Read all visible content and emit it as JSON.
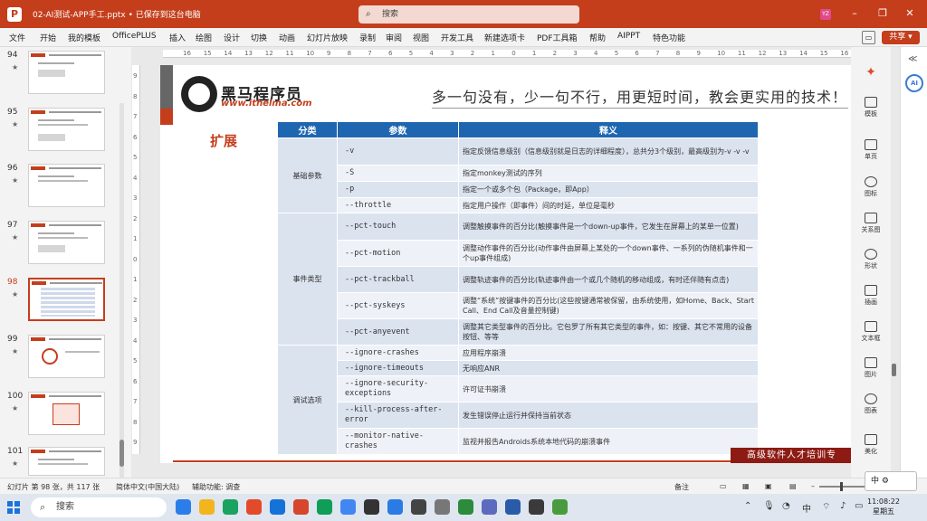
{
  "titlebar": {
    "app_icon": "P",
    "doc_title": "02-AI测试-APP手工.pptx • 已保存到这台电脑",
    "search_placeholder": "搜索",
    "user_initials": "YZ",
    "minimize": "–",
    "restore": "❐",
    "close": "✕"
  },
  "menu": [
    "文件",
    "开始",
    "我的模板",
    "OfficePLUS",
    "插入",
    "绘图",
    "设计",
    "切换",
    "动画",
    "幻灯片放映",
    "录制",
    "审阅",
    "视图",
    "开发工具",
    "新建选项卡",
    "PDF工具箱",
    "帮助",
    "AIPPT",
    "特色功能"
  ],
  "share_label": "共享",
  "thumbnails": [
    {
      "num": "94",
      "star": "★"
    },
    {
      "num": "95",
      "star": "★"
    },
    {
      "num": "96",
      "star": "★"
    },
    {
      "num": "97",
      "star": "★"
    },
    {
      "num": "98",
      "star": "★"
    },
    {
      "num": "99",
      "star": "★"
    },
    {
      "num": "100",
      "star": "★"
    },
    {
      "num": "101",
      "star": "★"
    }
  ],
  "ruler_h": [
    "16",
    "15",
    "14",
    "13",
    "12",
    "11",
    "10",
    "9",
    "8",
    "7",
    "6",
    "5",
    "4",
    "3",
    "2",
    "1",
    "0",
    "1",
    "2",
    "3",
    "4",
    "5",
    "6",
    "7",
    "8",
    "9",
    "10",
    "11",
    "12",
    "13",
    "14",
    "15",
    "16"
  ],
  "ruler_v": [
    "9",
    "8",
    "7",
    "6",
    "5",
    "4",
    "3",
    "2",
    "1",
    "0",
    "1",
    "2",
    "3",
    "4",
    "5",
    "6",
    "7",
    "8",
    "9"
  ],
  "slide": {
    "logo_name": "黑马程序员",
    "logo_url": "www.itheima.com",
    "slogan": "多一句没有，少一句不行，用更短时间，教会更实用的技术！",
    "section_title": "扩展",
    "footer": "高级软件人才培训专",
    "table": {
      "headers": [
        "分类",
        "参数",
        "释义"
      ],
      "groups": [
        {
          "category": "基础参数",
          "rows": [
            {
              "param": "-v",
              "desc": "指定反馈信息级别（信息级别就是日志的详细程度），总共分3个级别，最高级别为-v -v -v"
            },
            {
              "param": "-S",
              "desc": "指定monkey测试的序列"
            },
            {
              "param": "-p",
              "desc": "指定一个或多个包（Package，即App）"
            },
            {
              "param": "--throttle",
              "desc": "指定用户操作（即事件）间的时延，单位是毫秒"
            }
          ]
        },
        {
          "category": "事件类型",
          "rows": [
            {
              "param": "--pct-touch",
              "desc": "调整触摸事件的百分比(触摸事件是一个down-up事件，它发生在屏幕上的某单一位置)"
            },
            {
              "param": "--pct-motion",
              "desc": "调整动作事件的百分比(动作事件由屏幕上某处的一个down事件、一系列的伪随机事件和一个up事件组成)"
            },
            {
              "param": "--pct-trackball",
              "desc": "调整轨迹事件的百分比(轨迹事件由一个或几个随机的移动组成，有时还伴随有点击)"
            },
            {
              "param": "--pct-syskeys",
              "desc": "调整“系统”按键事件的百分比(这些按键通常被保留，由系统使用，如Home、Back、Start Call、End Call及音量控制键)"
            },
            {
              "param": "--pct-anyevent",
              "desc": "调整其它类型事件的百分比。它包罗了所有其它类型的事件，如：按键、其它不常用的设备按钮、等等"
            }
          ]
        },
        {
          "category": "调试选项",
          "rows": [
            {
              "param": "--ignore-crashes",
              "desc": "应用程序崩溃"
            },
            {
              "param": "--ignore-timeouts",
              "desc": "无响应ANR"
            },
            {
              "param": "--ignore-security-exceptions",
              "desc": "许可证书崩溃"
            },
            {
              "param": "--kill-process-after-error",
              "desc": "发生错误停止运行并保持当前状态"
            },
            {
              "param": "--monitor-native-crashes",
              "desc": "监视并报告Androids系统本地代码的崩溃事件"
            }
          ]
        }
      ]
    }
  },
  "right_panel": [
    "模板",
    "单页",
    "图标",
    "关系图",
    "形状",
    "插画",
    "文本框",
    "图片",
    "图表",
    "美化"
  ],
  "statusbar": {
    "slide_info": "幻灯片 第 98 张，共 117 张",
    "language": "简体中文(中国大陆)",
    "accessibility": "辅助功能: 调查",
    "notes": "备注",
    "zoom_minus": "–",
    "zoom_plus": "+"
  },
  "ime": "中",
  "taskbar": {
    "search_placeholder": "搜索",
    "time": "11:08:22",
    "day": "星期五",
    "apps": [
      "#2b7de9",
      "#f2b51d",
      "#1aa260",
      "#e24a2a",
      "#1572d8",
      "#d7452b",
      "#0f9d58",
      "#4286f4",
      "#333333",
      "#2a7be4",
      "#444444",
      "#777777",
      "#2d8b3c",
      "#5c6bc0",
      "#2a5ba8",
      "#3a3a3a",
      "#4a9b3f"
    ]
  }
}
